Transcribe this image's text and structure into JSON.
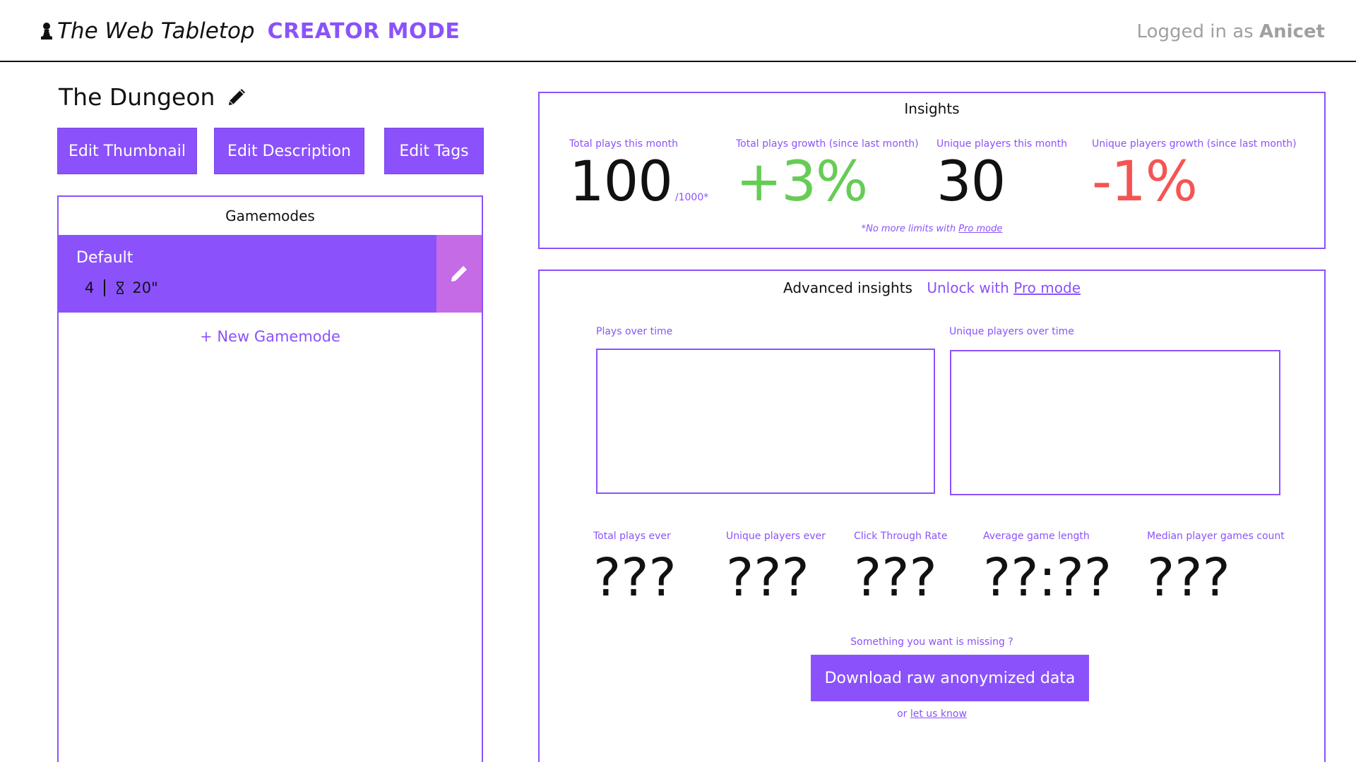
{
  "header": {
    "brand_name": "The Web Tabletop",
    "mode": "CREATOR MODE",
    "login_prefix": "Logged in as",
    "username": "Anicet"
  },
  "game": {
    "title": "The Dungeon"
  },
  "buttons": {
    "edit_thumbnail": "Edit Thumbnail",
    "edit_description": "Edit Description",
    "edit_tags": "Edit Tags"
  },
  "gamemodes": {
    "title": "Gamemodes",
    "items": [
      {
        "name": "Default",
        "players": "4",
        "duration": "20\""
      }
    ],
    "new_label": "+ New Gamemode"
  },
  "insights": {
    "title": "Insights",
    "metrics": [
      {
        "label": "Total plays this month",
        "value": "100",
        "cap": "/1000*"
      },
      {
        "label": "Total plays growth (since last month)",
        "value": "+3%"
      },
      {
        "label": "Unique players this month",
        "value": "30"
      },
      {
        "label": "Unique players growth (since last month)",
        "value": "-1%"
      }
    ],
    "note_prefix": "*No more limits with",
    "note_link": "Pro mode"
  },
  "advanced": {
    "title": "Advanced insights",
    "unlock_prefix": "Unlock with",
    "unlock_link": "Pro mode",
    "charts": [
      {
        "label": "Plays over time"
      },
      {
        "label": "Unique players over time"
      }
    ],
    "stats": [
      {
        "label": "Total plays ever",
        "value": "???"
      },
      {
        "label": "Unique players ever",
        "value": "???"
      },
      {
        "label": "Click Through Rate",
        "value": "???"
      },
      {
        "label": "Average game length",
        "value": "??:??"
      },
      {
        "label": "Median player games count",
        "value": "???"
      }
    ],
    "missing_text": "Something you want is missing ?",
    "download_label": "Download raw anonymized data",
    "feedback_prefix": "or",
    "feedback_link": "let us know"
  },
  "colors": {
    "accent": "#8b52fb",
    "accent_light": "#c56be6",
    "positive": "#66cc55",
    "negative": "#f55454"
  },
  "icons": [
    "pawn-icon",
    "pencil-icon",
    "hourglass-icon",
    "edit-icon"
  ]
}
